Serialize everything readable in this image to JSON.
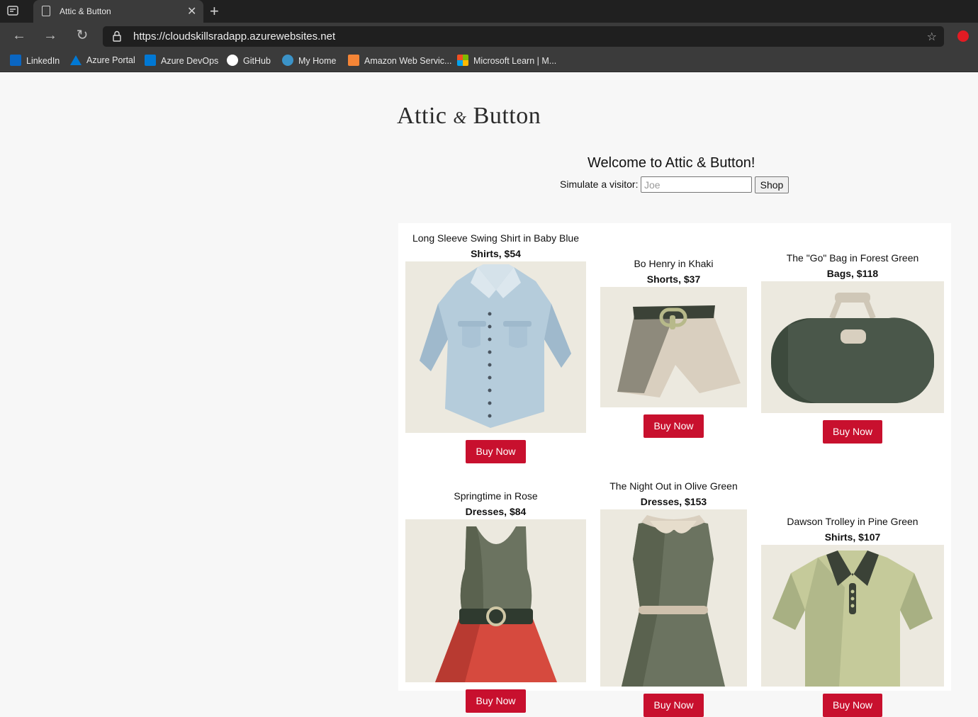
{
  "browser": {
    "tab_title": "Attic & Button",
    "url": "https://cloudskillsradapp.azurewebsites.net",
    "bookmarks": [
      {
        "label": "LinkedIn",
        "icon": "linkedin-icon",
        "color": "#0a66c2"
      },
      {
        "label": "Azure Portal",
        "icon": "azure-icon",
        "color": "#0078d4"
      },
      {
        "label": "Azure DevOps",
        "icon": "devops-icon",
        "color": "#0078d4"
      },
      {
        "label": "GitHub",
        "icon": "github-icon",
        "color": "#ffffff"
      },
      {
        "label": "My Home",
        "icon": "wordpress-icon",
        "color": "#3b93c8"
      },
      {
        "label": "Amazon Web Servic...",
        "icon": "aws-icon",
        "color": "#f58536"
      },
      {
        "label": "Microsoft Learn | M...",
        "icon": "microsoft-icon",
        "color": "#f25022"
      }
    ]
  },
  "page": {
    "logo_left": "Attic",
    "logo_amp": "&",
    "logo_right": "Button",
    "welcome": "Welcome to Attic & Button!",
    "simulate_label": "Simulate a visitor:",
    "visitor_placeholder": "Joe",
    "shop_button": "Shop"
  },
  "products": [
    {
      "name": "Long Sleeve Swing Shirt in Baby Blue",
      "category_price": "Shirts, $54",
      "buy": "Buy Now",
      "image": "shirt-baby-blue"
    },
    {
      "name": "Bo Henry in Khaki",
      "category_price": "Shorts, $37",
      "buy": "Buy Now",
      "image": "shorts-khaki"
    },
    {
      "name": "The \"Go\" Bag in Forest Green",
      "category_price": "Bags, $118",
      "buy": "Buy Now",
      "image": "bag-forest-green"
    },
    {
      "name": "Springtime in Rose",
      "category_price": "Dresses, $84",
      "buy": "Buy Now",
      "image": "dress-rose"
    },
    {
      "name": "The Night Out in Olive Green",
      "category_price": "Dresses, $153",
      "buy": "Buy Now",
      "image": "dress-olive"
    },
    {
      "name": "Dawson Trolley in Pine Green",
      "category_price": "Shirts, $107",
      "buy": "Buy Now",
      "image": "polo-pine-green"
    }
  ],
  "colors": {
    "accent": "#c8102e",
    "image_bg": "#ece9df"
  }
}
